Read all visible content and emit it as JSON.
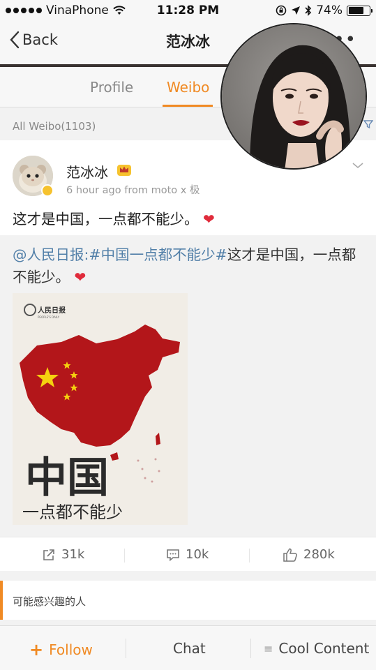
{
  "status_bar": {
    "carrier": "VinaPhone",
    "time": "11:28 PM",
    "battery": "74%",
    "battery_level": 0.74
  },
  "nav": {
    "back_label": "Back",
    "title": "范冰冰",
    "more_label": "•••"
  },
  "tabs": [
    {
      "label": "Profile",
      "active": false
    },
    {
      "label": "Weibo",
      "active": true
    }
  ],
  "feed_header": {
    "count_label": "All Weibo(1103)"
  },
  "post": {
    "author": "范冰冰",
    "meta": "6 hour ago  from moto x 极",
    "text": "这才是中国，一点都不能少。",
    "heart": "❤",
    "repost": {
      "mention": "@人民日报",
      "topic": ":#中国一点都不能少#",
      "text": "这才是中国，一点都不能少。",
      "heart": "❤",
      "image": {
        "logo_text": "人民日报",
        "logo_sub": "PEOPLE'S DAILY",
        "title": "中国",
        "subtitle": "一点都不能少"
      }
    },
    "actions": {
      "share_count": "31k",
      "comment_count": "10k",
      "like_count": "280k"
    }
  },
  "suggestions": {
    "label": "可能感兴趣的人"
  },
  "bottom_bar": {
    "follow_label": "Follow",
    "follow_prefix": "+",
    "chat_label": "Chat",
    "cool_label": "Cool Content",
    "cool_prefix": "≡"
  },
  "colors": {
    "accent": "#f08a24",
    "link": "#517fa8",
    "heart": "#e02b3b",
    "map_red": "#b3161a",
    "star": "#f5d10f"
  }
}
